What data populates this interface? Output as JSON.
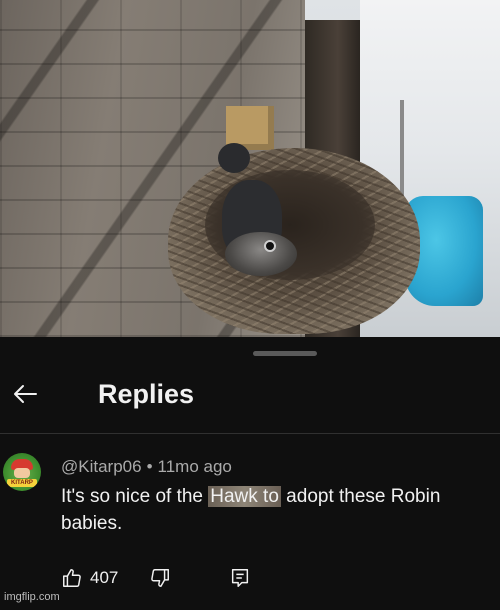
{
  "photo": {
    "description_icon": "nest-photo"
  },
  "sheet": {
    "title": "Replies",
    "back_icon": "arrow-left-icon"
  },
  "comment": {
    "author": "@Kitarp06",
    "separator": "•",
    "age": "11mo ago",
    "text_before": "It's so nice of the ",
    "text_highlight": "Hawk to",
    "text_after": " adopt these  Robin babies.",
    "likes": "407",
    "avatar_tag": "KITARP"
  },
  "watermark": "imgflip.com",
  "colors": {
    "background": "#0f0f0f",
    "primary_text": "#f1f1f1",
    "secondary_text": "#aaaaaa",
    "divider": "#303030"
  }
}
